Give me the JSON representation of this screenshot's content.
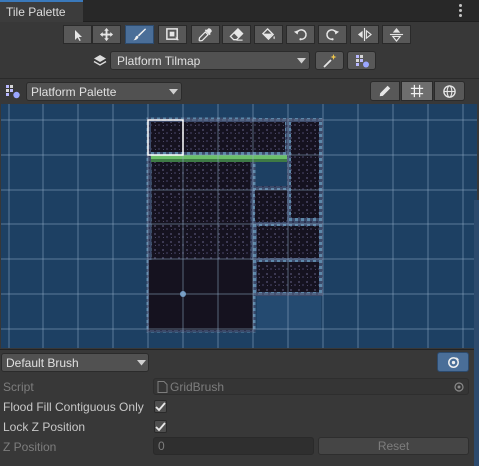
{
  "window": {
    "tab_title": "Tile Palette"
  },
  "toolbar": {
    "tools": [
      {
        "name": "select-tool",
        "icon": "arrow-pointer-icon"
      },
      {
        "name": "move-tool",
        "icon": "move-arrows-icon"
      },
      {
        "name": "paint-tool",
        "icon": "paintbrush-icon",
        "active": true
      },
      {
        "name": "box-fill-tool",
        "icon": "box-fill-icon"
      },
      {
        "name": "picker-tool",
        "icon": "eyedropper-icon"
      },
      {
        "name": "erase-tool",
        "icon": "eraser-icon"
      },
      {
        "name": "fill-tool",
        "icon": "paint-bucket-icon"
      },
      {
        "name": "rotate-ccw-tool",
        "icon": "rotate-left-icon"
      },
      {
        "name": "rotate-cw-tool",
        "icon": "rotate-right-icon"
      },
      {
        "name": "flip-x-tool",
        "icon": "flip-horizontal-icon"
      },
      {
        "name": "flip-y-tool",
        "icon": "flip-vertical-icon"
      }
    ],
    "active_tilemap": "Platform Tilmap"
  },
  "palette": {
    "selected": "Platform Palette"
  },
  "brush": {
    "selected": "Default Brush",
    "script_label": "Script",
    "script_value": "GridBrush",
    "flood_fill_label": "Flood Fill Contiguous Only",
    "flood_fill_checked": true,
    "lock_z_label": "Lock Z Position",
    "lock_z_checked": true,
    "z_position_label": "Z Position",
    "z_position_value": "0",
    "reset_label": "Reset"
  },
  "colors": {
    "accent": "#3a79bb",
    "active_tool": "#4a6e98",
    "canvas_bg": "#1d4063",
    "grass": "#6bbf6a"
  }
}
